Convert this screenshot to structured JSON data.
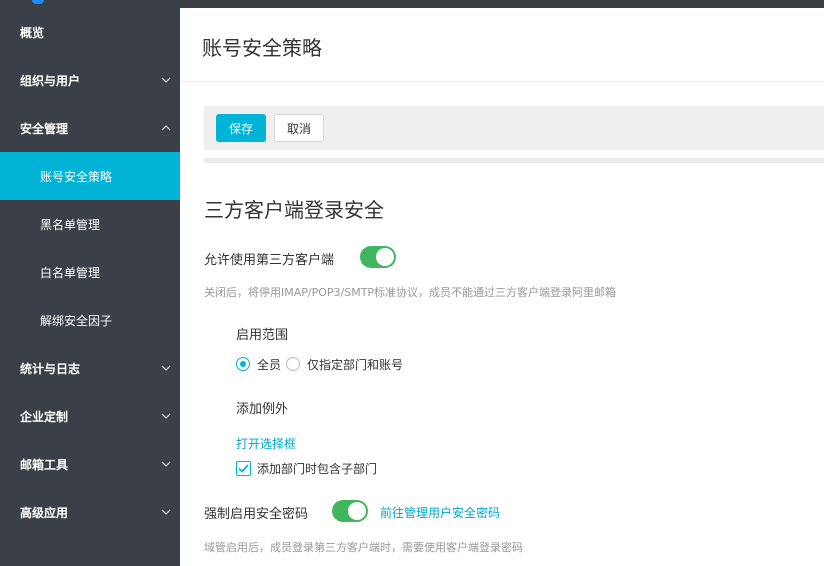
{
  "sidebar": {
    "items": [
      {
        "label": "概览",
        "icon": "none"
      },
      {
        "label": "组织与用户",
        "icon": "chevron-down-icon"
      },
      {
        "label": "安全管理",
        "icon": "chevron-up-icon"
      },
      {
        "label": "账号安全策略",
        "active": true
      },
      {
        "label": "黑名单管理"
      },
      {
        "label": "白名单管理"
      },
      {
        "label": "解绑安全因子"
      },
      {
        "label": "统计与日志",
        "icon": "chevron-down-icon"
      },
      {
        "label": "企业定制",
        "icon": "chevron-down-icon"
      },
      {
        "label": "邮箱工具",
        "icon": "chevron-down-icon"
      },
      {
        "label": "高级应用",
        "icon": "chevron-down-icon"
      }
    ]
  },
  "header": {
    "title": "账号安全策略"
  },
  "toolbar": {
    "save_label": "保存",
    "cancel_label": "取消"
  },
  "section": {
    "title": "三方客户端登录安全",
    "allow_third_party": {
      "label": "允许使用第三方客户端",
      "enabled": true,
      "hint": "关闭后，将停用IMAP/POP3/SMTP标准协议，成员不能通过三方客户端登录阿里邮箱"
    },
    "scope": {
      "label": "启用范围",
      "options": [
        "全员",
        "仅指定部门和账号"
      ],
      "selected": "全员"
    },
    "exceptions": {
      "label": "添加例外",
      "open_selector_link": "打开选择框",
      "include_subdept_label": "添加部门时包含子部门",
      "include_subdept_checked": true
    },
    "force_password": {
      "label": "强制启用安全密码",
      "enabled": true,
      "link": "前往管理用户安全密码",
      "hint": "域管启用后，成员登录第三方客户端时，需要使用客户端登录密码"
    }
  },
  "colors": {
    "accent": "#00b3d7",
    "toggle_on": "#3fb65e",
    "sidebar_bg": "#3b4048",
    "link": "#00a8cc"
  }
}
